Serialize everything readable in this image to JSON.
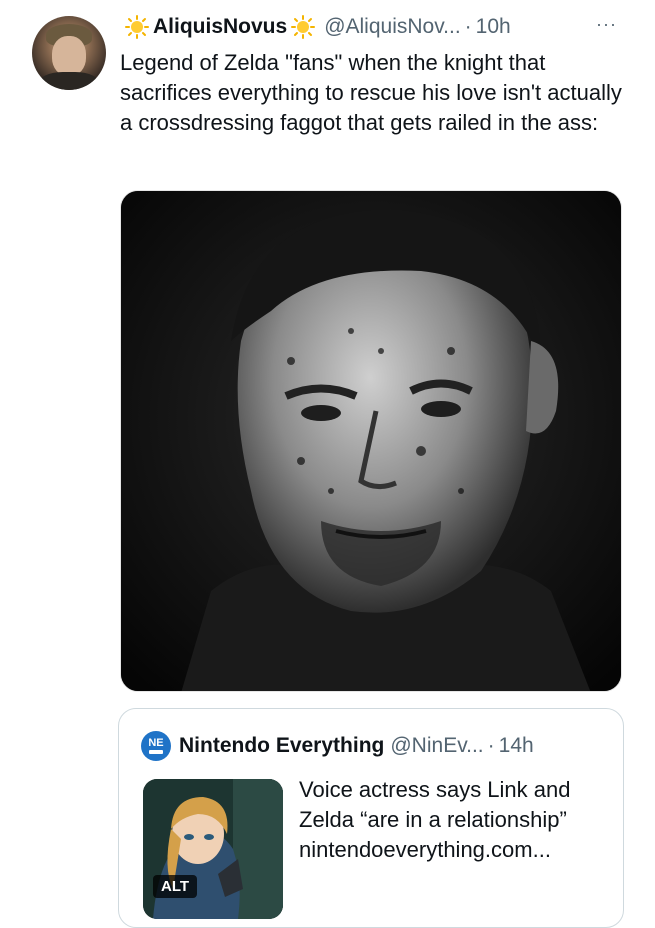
{
  "tweet": {
    "author_name": "AliquisNovus",
    "handle": "@AliquisNov...",
    "separator": "·",
    "time": "10h",
    "more": "···",
    "text": "Legend of Zelda \"fans\" when the knight that sacrifices everything to rescue his love isn't actually a crossdressing faggot that gets railed in the ass:",
    "name_badge_icon": "sun-emoji-icon"
  },
  "quoted": {
    "author_name": "Nintendo Everything",
    "handle": "@NinEv...",
    "separator": "·",
    "time": "14h",
    "logo_text": "NE",
    "text": "Voice actress says Link and Zelda “are in a relationship” nintendoeverything.com...",
    "alt_label": "ALT"
  },
  "colors": {
    "text": "#0f1419",
    "secondary": "#536471",
    "border": "#cfd9de",
    "nintendo_blue": "#1f73c7"
  }
}
